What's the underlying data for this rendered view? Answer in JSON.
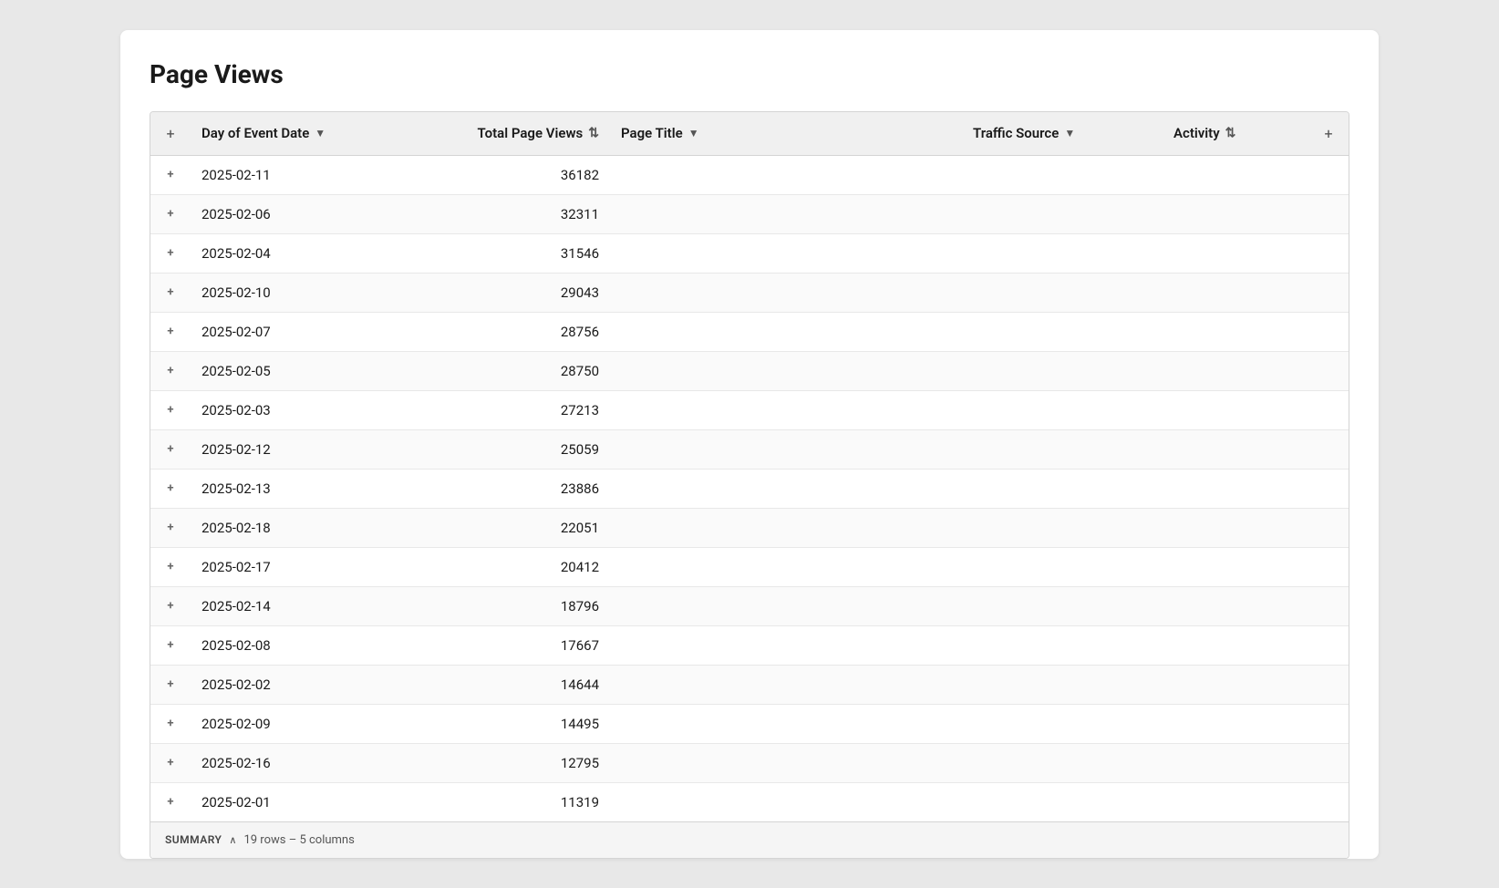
{
  "title": "Page Views",
  "summary": {
    "label": "SUMMARY",
    "detail": "19 rows – 5 columns"
  },
  "columns": {
    "add_left": "+",
    "date": "Day of Event Date",
    "views": "Total Page Views",
    "title": "Page Title",
    "source": "Traffic Source",
    "activity": "Activity",
    "add_right": "+"
  },
  "rows": [
    {
      "date": "2025-02-11",
      "views": "36182"
    },
    {
      "date": "2025-02-06",
      "views": "32311"
    },
    {
      "date": "2025-02-04",
      "views": "31546"
    },
    {
      "date": "2025-02-10",
      "views": "29043"
    },
    {
      "date": "2025-02-07",
      "views": "28756"
    },
    {
      "date": "2025-02-05",
      "views": "28750"
    },
    {
      "date": "2025-02-03",
      "views": "27213"
    },
    {
      "date": "2025-02-12",
      "views": "25059"
    },
    {
      "date": "2025-02-13",
      "views": "23886"
    },
    {
      "date": "2025-02-18",
      "views": "22051"
    },
    {
      "date": "2025-02-17",
      "views": "20412"
    },
    {
      "date": "2025-02-14",
      "views": "18796"
    },
    {
      "date": "2025-02-08",
      "views": "17667"
    },
    {
      "date": "2025-02-02",
      "views": "14644"
    },
    {
      "date": "2025-02-09",
      "views": "14495"
    },
    {
      "date": "2025-02-16",
      "views": "12795"
    },
    {
      "date": "2025-02-01",
      "views": "11319"
    }
  ]
}
